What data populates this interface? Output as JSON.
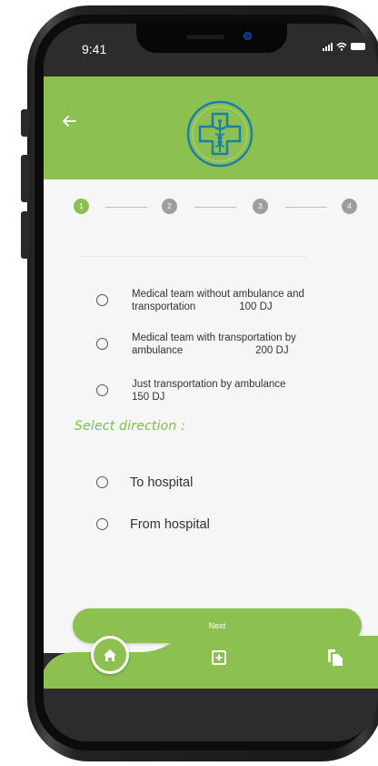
{
  "status_bar": {
    "time": "9:41"
  },
  "colors": {
    "brand_green": "#8cc152",
    "logo_teal": "#1f7ea3",
    "accent_title": "#7cc046"
  },
  "header": {
    "back_icon": "arrow-left-icon",
    "logo_icon": "medical-caduceus-logo"
  },
  "stepper": {
    "steps": [
      {
        "number": "1",
        "state": "active"
      },
      {
        "number": "2",
        "state": "inactive"
      },
      {
        "number": "3",
        "state": "inactive"
      },
      {
        "number": "4",
        "state": "inactive"
      }
    ]
  },
  "service_options": [
    {
      "text": "Medical team without ambulance and\ntransportation               100 DJ"
    },
    {
      "text": "Medical team with transportation by\nambulance                         200 DJ"
    },
    {
      "text": "Just transportation by ambulance\n150 DJ"
    }
  ],
  "direction": {
    "title": "Select direction :",
    "options": [
      {
        "text": "To hospital"
      },
      {
        "text": "From hospital"
      }
    ]
  },
  "next_button": {
    "label": "Next"
  },
  "bottom_nav": {
    "items": [
      "home-icon",
      "add-box-icon",
      "copy-icon"
    ]
  }
}
